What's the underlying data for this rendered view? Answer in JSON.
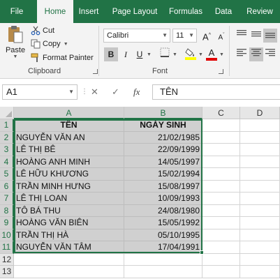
{
  "ribbon_tabs": [
    {
      "label": "File"
    },
    {
      "label": "Home"
    },
    {
      "label": "Insert"
    },
    {
      "label": "Page Layout"
    },
    {
      "label": "Formulas"
    },
    {
      "label": "Data"
    },
    {
      "label": "Review"
    }
  ],
  "active_tab": "Home",
  "clipboard": {
    "group_label": "Clipboard",
    "paste_label": "Paste",
    "cut_label": "Cut",
    "copy_label": "Copy",
    "format_painter_label": "Format Painter"
  },
  "font": {
    "group_label": "Font",
    "family": "Calibri",
    "size": "11",
    "bold_glyph": "B",
    "italic_glyph": "I",
    "underline_glyph": "U",
    "grow_glyph": "A",
    "shrink_glyph": "A",
    "font_color_glyph": "A",
    "font_color": "#e00000",
    "fill_color": "#ffff00"
  },
  "formula_bar": {
    "name_box": "A1",
    "cancel_glyph": "✕",
    "enter_glyph": "✓",
    "fx_glyph": "fx",
    "content": "TÊN"
  },
  "sheet": {
    "columns": [
      "A",
      "B",
      "C",
      "D"
    ],
    "rows": [
      "1",
      "2",
      "3",
      "4",
      "5",
      "6",
      "7",
      "8",
      "9",
      "10",
      "11",
      "12",
      "13"
    ],
    "header": {
      "name": "TÊN",
      "birth": "NGÀY SINH"
    },
    "records": [
      {
        "name": "NGUYỄN VĂN AN",
        "birth": "21/02/1985"
      },
      {
        "name": "LÊ THỊ BÊ",
        "birth": "22/09/1999"
      },
      {
        "name": "HOÀNG ANH MINH",
        "birth": "14/05/1997"
      },
      {
        "name": "LÊ HỮU KHƯƠNG",
        "birth": "15/02/1994"
      },
      {
        "name": "TRẦN MINH HƯNG",
        "birth": "15/08/1997"
      },
      {
        "name": "LÊ THỊ LOAN",
        "birth": "10/09/1993"
      },
      {
        "name": "TÔ BÁ THU",
        "birth": "24/08/1980"
      },
      {
        "name": "HOÀNG VĂN BIÊN",
        "birth": "15/05/1992"
      },
      {
        "name": "TRẦN THỊ HÀ",
        "birth": "05/10/1995"
      },
      {
        "name": "NGUYỄN VĂN TÂM",
        "birth": "17/04/1991"
      }
    ],
    "selected_range": "A1:B11",
    "accent_color": "#217346"
  }
}
